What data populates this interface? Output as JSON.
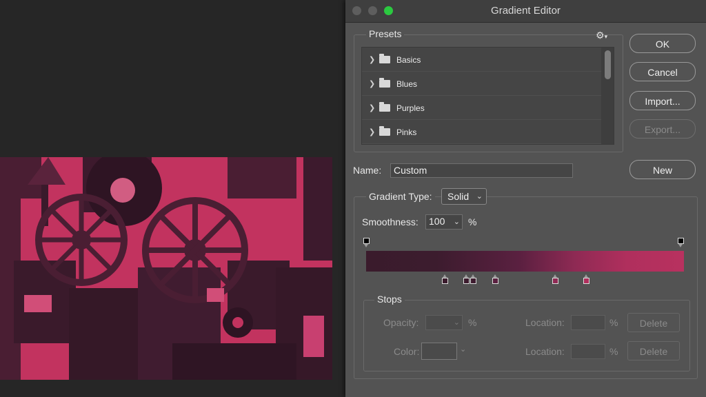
{
  "window": {
    "title": "Gradient Editor"
  },
  "presets": {
    "label": "Presets",
    "items": [
      {
        "label": "Basics"
      },
      {
        "label": "Blues"
      },
      {
        "label": "Purples"
      },
      {
        "label": "Pinks"
      }
    ]
  },
  "buttons": {
    "ok": "OK",
    "cancel": "Cancel",
    "import": "Import...",
    "export": "Export...",
    "new": "New"
  },
  "name": {
    "label": "Name:",
    "value": "Custom"
  },
  "gradient_type": {
    "label": "Gradient Type:",
    "value": "Solid"
  },
  "smoothness": {
    "label": "Smoothness:",
    "value": "100",
    "unit": "%"
  },
  "stops": {
    "label": "Stops",
    "opacity_label": "Opacity:",
    "color_label": "Color:",
    "location_label": "Location:",
    "percent": "%",
    "delete_label": "Delete"
  },
  "colors": {
    "accent_pink": "#c2335f",
    "dark_plum": "#3a1b2c",
    "dialog_bg": "#535353"
  }
}
